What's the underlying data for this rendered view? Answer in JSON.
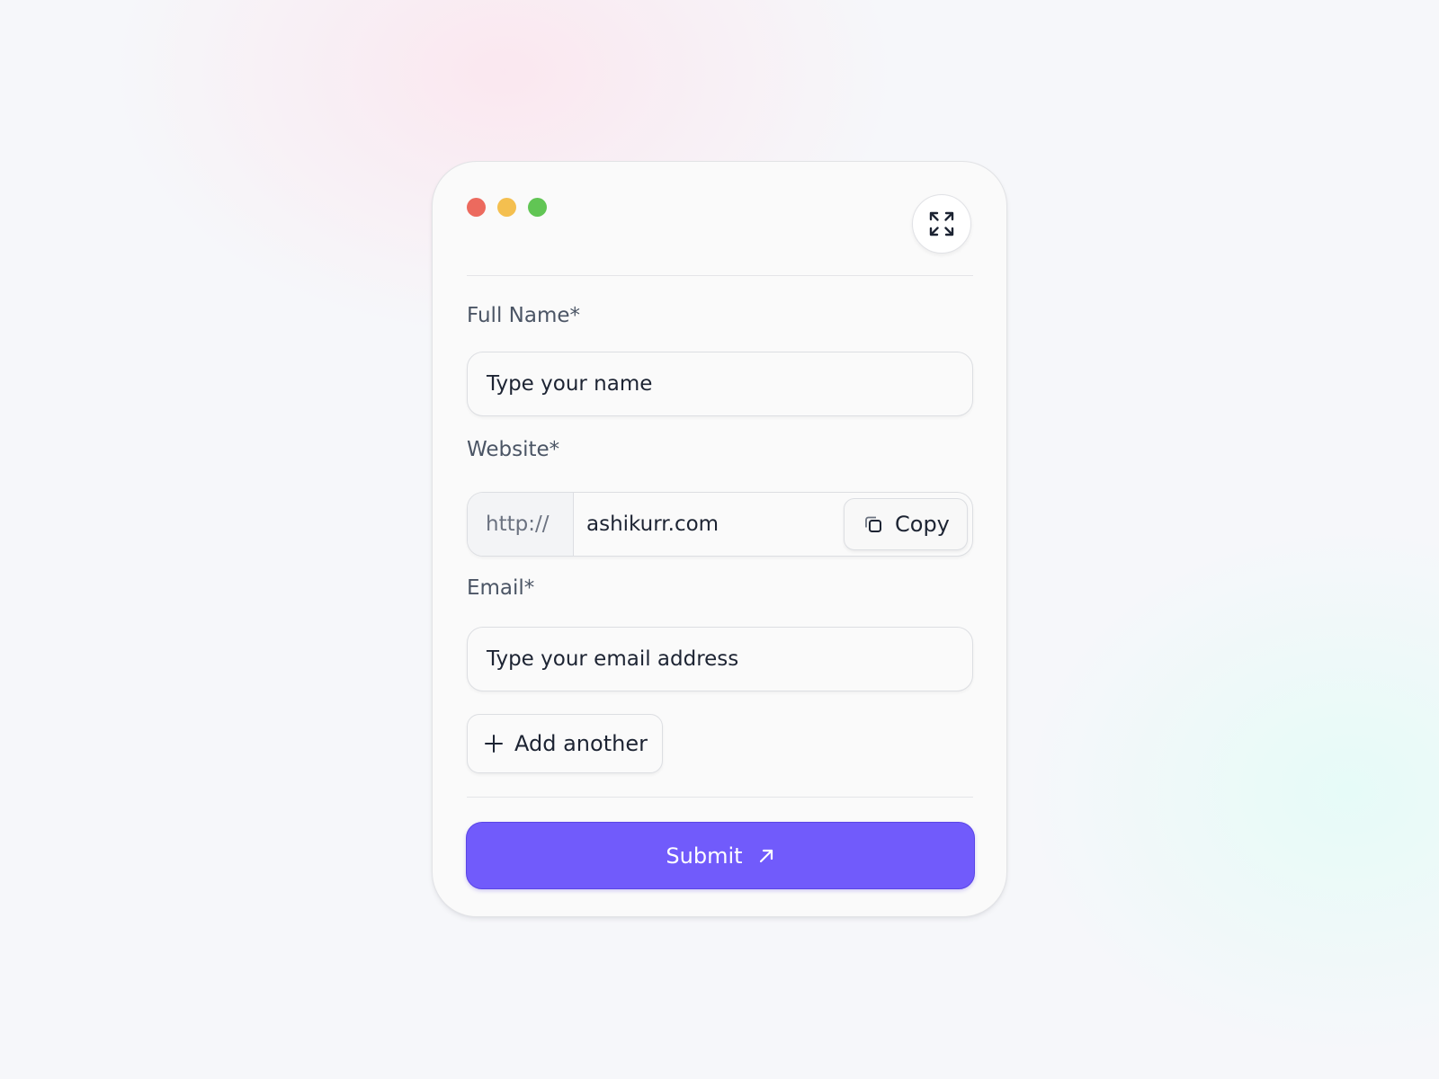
{
  "window": {
    "controls": [
      "close",
      "minimize",
      "maximize"
    ],
    "expand_icon": "expand-icon"
  },
  "form": {
    "full_name": {
      "label": "Full Name*",
      "placeholder": "Type your name",
      "value": ""
    },
    "website": {
      "label": "Website*",
      "prefix": "http://",
      "value": "ashikurr.com",
      "copy_label": "Copy",
      "copy_icon": "copy-icon"
    },
    "email": {
      "label": "Email*",
      "placeholder": "Type your email address",
      "value": ""
    },
    "add_another_label": "Add another",
    "add_icon": "plus-icon",
    "submit_label": "Submit",
    "submit_icon": "arrow-up-right-icon"
  },
  "colors": {
    "accent": "#715bfb",
    "close": "#ec6a5e",
    "minimize": "#f4bf4f",
    "maximize": "#61c554"
  }
}
